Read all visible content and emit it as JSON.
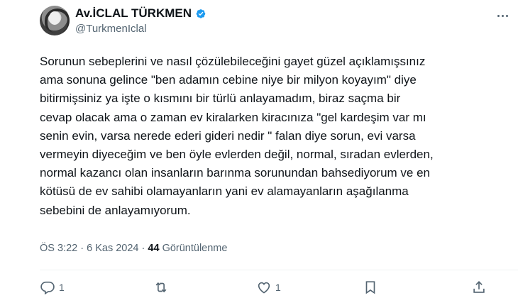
{
  "author": {
    "display_name": "Av.İCLAL TÜRKMEN",
    "handle": "@TurkmenIclal",
    "verified": true
  },
  "tweet": {
    "text": "Sorunun sebeplerini ve nasıl çözülebileceğini gayet güzel açıklamışsınız\nama sonuna gelince \"ben adamın cebine niye bir milyon koyayım\" diye\nbitirmişsiniz ya işte o kısmını bir türlü anlayamadım, biraz saçma bir\ncevap olacak ama o zaman ev kiralarken kiracınıza \"gel kardeşim var mı\nsenin evin, varsa nerede ederi gideri nedir \" falan diye sorun, evi varsa\nvermeyin diyeceğim ve ben öyle evlerden değil, normal, sıradan evlerden,\nnormal kazancı olan insanların barınma sorunundan bahsediyorum ve en\nkötüsü de ev sahibi olamayanların yani ev alamayanların aşağılanma\nsebebini de anlayamıyorum.",
    "time": "ÖS 3:22",
    "date": "6 Kas 2024",
    "separator": "·",
    "views_count": "44",
    "views_label": "Görüntülenme"
  },
  "actions": {
    "reply_count": "1",
    "retweet_count": "",
    "like_count": "1",
    "bookmark_count": ""
  },
  "icons": [
    "verified-badge-icon",
    "more-options-icon",
    "reply-icon",
    "retweet-icon",
    "like-icon",
    "bookmark-icon",
    "share-icon"
  ],
  "colors": {
    "verified": "#1d9bf0",
    "text": "#0f1419",
    "secondary": "#536471"
  }
}
